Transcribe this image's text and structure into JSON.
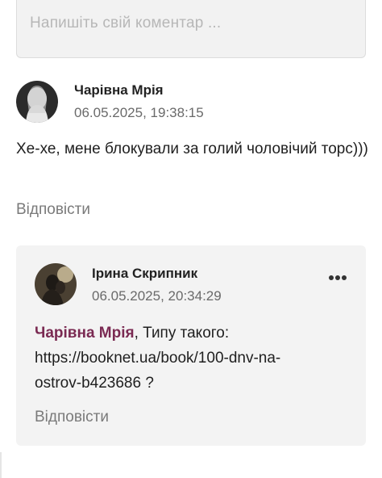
{
  "comment_form": {
    "placeholder": "Напишіть свій коментар ..."
  },
  "comments": [
    {
      "author": "Чарівна Мрія",
      "date": "06.05.2025, 19:38:15",
      "text": "Хе-хе, мене блокували за голий чоловічий торс)))",
      "reply_label": "Відповісти",
      "replies": [
        {
          "author": "Ірина Скрипник",
          "date": "06.05.2025, 20:34:29",
          "mention": "Чарівна Мрія",
          "text_after_mention": ", Типу такого:",
          "link_text": "https://booknet.ua/book/100-dnv-na-ostrov-b423686",
          "text_end": " ?",
          "reply_label": "Відповісти",
          "menu_icon": "more-dots-icon"
        }
      ]
    }
  ]
}
